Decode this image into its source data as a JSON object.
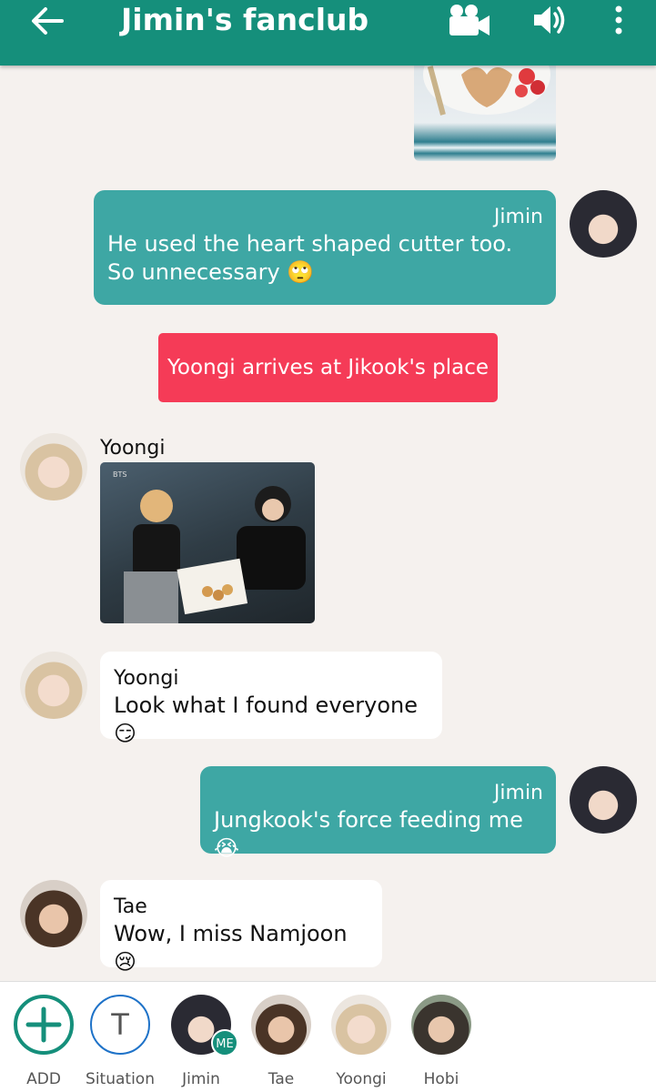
{
  "header": {
    "title": "Jimin's fanclub",
    "back_icon": "arrow-left-icon",
    "video_icon": "video-camera-icon",
    "sound_icon": "speaker-icon",
    "more_icon": "more-vertical-icon",
    "bg_color": "#158f7b"
  },
  "messages": [
    {
      "type": "image",
      "side": "out",
      "content": "pancake-photo"
    },
    {
      "type": "text",
      "side": "out",
      "sender": "Jimin",
      "text": "He used the heart shaped cutter too. So unnecessary",
      "emoji": "🙄"
    },
    {
      "type": "situation",
      "text": "Yoongi arrives at Jikook's place"
    },
    {
      "type": "image",
      "side": "in",
      "sender": "Yoongi",
      "content": "photo"
    },
    {
      "type": "text",
      "side": "in",
      "sender": "Yoongi",
      "text": "Look what I found everyone",
      "emoji": "😏"
    },
    {
      "type": "text",
      "side": "out",
      "sender": "Jimin",
      "text": "Jungkook's force feeding me",
      "emoji": "😭"
    },
    {
      "type": "text",
      "side": "in",
      "sender": "Tae",
      "text": "Wow, I miss Namjoon",
      "emoji": "😢"
    }
  ],
  "photo_watermark": "BTS",
  "bottom_bar": {
    "chips": [
      {
        "label": "ADD",
        "icon": "plus-icon"
      },
      {
        "label": "Situation",
        "icon": "T"
      },
      {
        "label": "Jimin",
        "badge": "ME"
      },
      {
        "label": "Tae"
      },
      {
        "label": "Yoongi"
      },
      {
        "label": "Hobi"
      }
    ]
  },
  "colors": {
    "outgoing_bubble": "#3ea7a4",
    "incoming_bubble": "#ffffff",
    "situation": "#f53b57",
    "background": "#f5f1ee"
  }
}
